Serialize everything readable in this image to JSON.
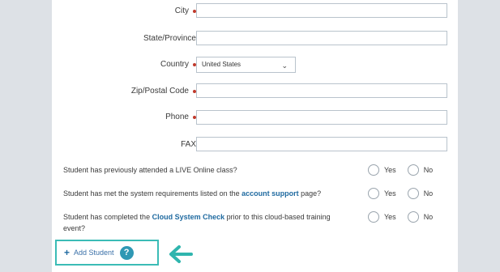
{
  "form": {
    "fields": [
      {
        "label": "City",
        "required": true,
        "value": ""
      },
      {
        "label": "State/Province",
        "required": false,
        "value": ""
      },
      {
        "label": "Country",
        "required": true,
        "value": "United States"
      },
      {
        "label": "Zip/Postal Code",
        "required": true,
        "value": ""
      },
      {
        "label": "Phone",
        "required": true,
        "value": ""
      },
      {
        "label": "FAX",
        "required": false,
        "value": ""
      }
    ],
    "questions": [
      {
        "text_before": "Student has previously attended a LIVE Online class?",
        "link": "",
        "text_after": ""
      },
      {
        "text_before": "Student has met the system requirements listed on the ",
        "link": "account support",
        "text_after": " page?"
      },
      {
        "text_before": "Student has completed the ",
        "link": "Cloud System Check",
        "text_after": " prior to this cloud-based training event?"
      }
    ],
    "radio_yes": "Yes",
    "radio_no": "No",
    "add_student_label": "Add Student",
    "help_glyph": "?"
  },
  "colors": {
    "required_marker": "#c0392b",
    "link": "#1f6aa0",
    "highlight_border": "#3bbcb6",
    "arrow": "#2fb5ae"
  },
  "icons": {
    "required": "required-dot-icon",
    "dropdown": "chevron-down-icon",
    "add": "plus-icon",
    "help": "help-icon",
    "arrow": "arrow-left-icon"
  }
}
